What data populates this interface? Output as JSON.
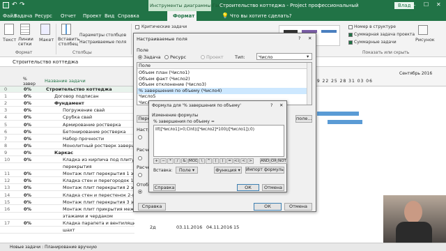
{
  "colors": {
    "accent": "#217346",
    "dialog_bg": "#f0f0f0",
    "selection": "#cde8ff"
  },
  "titlebar": {
    "save_icon": "save-icon",
    "undo_icon": "undo-icon",
    "title_center": "Инструменты диаграммы Ганта",
    "title_right": "Строительство коттеджа - Project профессиональный",
    "user": "Влад",
    "min": "‒",
    "max": "☐",
    "close": "✕"
  },
  "tabs": [
    "Файл",
    "Задача",
    "Ресурс",
    "Отчет",
    "Проект",
    "Вид",
    "Справка",
    "Формат"
  ],
  "tabs_positions_note": "",
  "search_placeholder": "Что вы хотите сделать?",
  "ribbon": {
    "btn_text": "Текст",
    "btn_gridlines": "Линии сетки",
    "btn_layout": "Макет",
    "btn_insert_column": "Вставить столбец",
    "param_columns": "Параметры столбцов",
    "custom_fields": "Настраиваемые поля",
    "group_format": "Формат",
    "group_columns": "Столбцы",
    "critical": "Критические задачи",
    "summary_number": "Номер в структуре",
    "summary_task": "Суммарная задача проекта",
    "summary_tasks": "Суммарные задачи",
    "group_show": "Показать или скрыть",
    "drawing": "Рисунок"
  },
  "formula_bar": {
    "value": "Строительство коттеджа"
  },
  "grid": {
    "header": {
      "pct_col": "% завер",
      "name_col": "Название задачи"
    },
    "rows": [
      {
        "id": "0",
        "pct": "0%",
        "name": "Строительство коттеджа",
        "level": 0,
        "bold": true
      },
      {
        "id": "1",
        "pct": "0%",
        "name": "Договор подписан",
        "level": 1,
        "bold": false
      },
      {
        "id": "2",
        "pct": "0%",
        "name": "Фундамент",
        "level": 1,
        "bold": true
      },
      {
        "id": "3",
        "pct": "0%",
        "name": "Погружение свай",
        "level": 2,
        "bold": false
      },
      {
        "id": "4",
        "pct": "0%",
        "name": "Срубка свай",
        "level": 2,
        "bold": false
      },
      {
        "id": "5",
        "pct": "0%",
        "name": "Армирование ростверка",
        "level": 2,
        "bold": false
      },
      {
        "id": "6",
        "pct": "0%",
        "name": "Бетонирование ростверка",
        "level": 2,
        "bold": false
      },
      {
        "id": "7",
        "pct": "0%",
        "name": "Набор прочности",
        "level": 2,
        "bold": false
      },
      {
        "id": "8",
        "pct": "0%",
        "name": "Монолитный ростверк завершен",
        "level": 2,
        "bold": false
      },
      {
        "id": "9",
        "pct": "0%",
        "name": "Каркас",
        "level": 1,
        "bold": true
      },
      {
        "id": "10",
        "pct": "0%",
        "name": "Кладка из кирпича под плиту",
        "level": 2,
        "bold": false
      },
      {
        "id": "",
        "pct": "",
        "name": "перекрытия",
        "level": 2,
        "bold": false
      },
      {
        "id": "11",
        "pct": "0%",
        "name": "Монтаж плит перекрытия 1 эта",
        "level": 2,
        "bold": false
      },
      {
        "id": "12",
        "pct": "0%",
        "name": "Кладка стен и перегородок 1-го",
        "level": 2,
        "bold": false
      },
      {
        "id": "13",
        "pct": "0%",
        "name": "Монтаж плит перекрытия 2 эта",
        "level": 2,
        "bold": false
      },
      {
        "id": "14",
        "pct": "0%",
        "name": "Кладка стен и перестенок 2-го",
        "level": 2,
        "bold": false
      },
      {
        "id": "15",
        "pct": "0%",
        "name": "Монтаж плит перекрытия 3 эта",
        "level": 2,
        "bold": false
      },
      {
        "id": "16",
        "pct": "0%",
        "name": "Монтаж плит прикрытия между",
        "level": 2,
        "bold": false
      },
      {
        "id": "",
        "pct": "",
        "name": "этажами и чердаком",
        "level": 2,
        "bold": false
      },
      {
        "id": "17",
        "pct": "0%",
        "name": "Кладка парапета и вентиляционных",
        "level": 2,
        "bold": false
      },
      {
        "id": "",
        "pct": "",
        "name": "шахт",
        "level": 2,
        "bold": false
      }
    ],
    "last_row": {
      "duration": "2д",
      "start": "03.11.2016",
      "finish": "04.11.2016",
      "pred": "15"
    }
  },
  "gantt": {
    "month_label": "Сентябрь 2016",
    "days": "19 22 25 28 31 03 06"
  },
  "status": {
    "new_tasks": "Новые задачи : Планирование вручную"
  },
  "custom_dialog": {
    "title": "Настраиваемые поля",
    "help": "?",
    "close": "✕",
    "field_label": "Поле",
    "radio_task": "Задача",
    "radio_resource": "Ресурс",
    "radio_project": "Проект",
    "type_label": "Тип:",
    "type_value": "Число",
    "list_header": "Поле",
    "list": [
      "Объем план (Число1)",
      "Объем факт (Число2)",
      "Объем отклонение (Число3)",
      "% завершения по объему (Число4)",
      "Число5",
      "Число6"
    ],
    "selected_index": 3,
    "rename_btn": "Пере",
    "import_btn": "поле...",
    "section_attr": "Настр",
    "section_calc1": "Расче",
    "section_calc2": "Расче",
    "section_display": "Отоб",
    "help_btn": "Справка",
    "ok_btn": "ОК",
    "cancel_btn": "Отмена"
  },
  "formula_dialog": {
    "title": "Формула для '% завершения по объему'",
    "help": "?",
    "close": "✕",
    "edit_label": "Изменение формулы",
    "field_line": "% завершения по объему =",
    "formula": "IIf([Число1]>0;CInt(([Число2]*100)/[Число1]);0)",
    "ops": [
      "+",
      "−",
      "*",
      "/",
      "&",
      "MOD",
      "\\",
      "^",
      "(",
      ")",
      "=",
      "<>",
      "<",
      ">",
      "AND",
      "OR",
      "NOT"
    ],
    "insert_label": "Вставка:",
    "field_btn": "Поле",
    "function_btn": "Функция",
    "import_formula_btn": "Импорт формулы...",
    "help_btn": "Справка",
    "ok_btn": "ОК",
    "cancel_btn": "Отмена"
  }
}
